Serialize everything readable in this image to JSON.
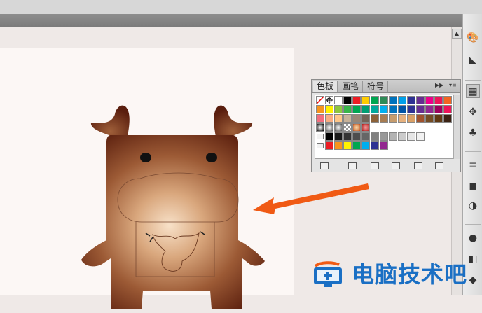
{
  "panel": {
    "tabs": [
      {
        "label": "色板"
      },
      {
        "label": "画笔"
      },
      {
        "label": "符号"
      }
    ],
    "menu_icons": [
      "expand-arrows-icon",
      "panel-menu-icon"
    ],
    "bottom_icons": [
      "swatch-library-icon",
      "show-kinds-icon",
      "swatch-options-icon",
      "new-color-group-icon",
      "new-swatch-icon",
      "delete-swatch-icon"
    ],
    "swatch_rows": [
      [
        "#ffffff",
        "#ffffff",
        "#ffffff",
        "#000000",
        "#ed1c24",
        "#ffcc00",
        "#00a651",
        "#2e8b57",
        "#0072bc",
        "#00a0e9",
        "#2e3192",
        "#662d91",
        "#ec008c",
        "#ed145b",
        "#f26522"
      ],
      [
        "#f7941d",
        "#fff200",
        "#8dc63f",
        "#39b54a",
        "#00a651",
        "#009e73",
        "#00a99d",
        "#00aeef",
        "#0072bc",
        "#0054a6",
        "#2e3192",
        "#662d91",
        "#92278f",
        "#9e005d",
        "#ed145b"
      ],
      [
        "#f26d7d",
        "#f9ad81",
        "#fdc689",
        "#c7b299",
        "#998675",
        "#736357",
        "#8c6239",
        "#a67c52",
        "#c69c6d",
        "#e6b17e",
        "#d9a066",
        "#a0522d",
        "#754c24",
        "#603913",
        "#3b2314"
      ]
    ],
    "gradient_swatches": [
      "radial-white-black",
      "radial-gray",
      "radial-blue",
      "checker",
      "radial-orange",
      "pattern-red"
    ],
    "gray_row": [
      "#000000",
      "#1a1a1a",
      "#333333",
      "#4d4d4d",
      "#666666",
      "#808080",
      "#999999",
      "#b3b3b3",
      "#cccccc",
      "#e6e6e6",
      "#f2f2f2"
    ],
    "bright_row": [
      "#ed1c24",
      "#f7941d",
      "#fff200",
      "#00a651",
      "#00aeef",
      "#2e3192",
      "#92278f"
    ]
  },
  "watermark": {
    "text": "电脑技术吧",
    "icon": "monitor-plus-logo"
  },
  "colors": {
    "cow_center": "#f7dcc0",
    "cow_edge": "#6b2a12",
    "arrow": "#f05a14",
    "watermark": "#1a6fc4"
  }
}
